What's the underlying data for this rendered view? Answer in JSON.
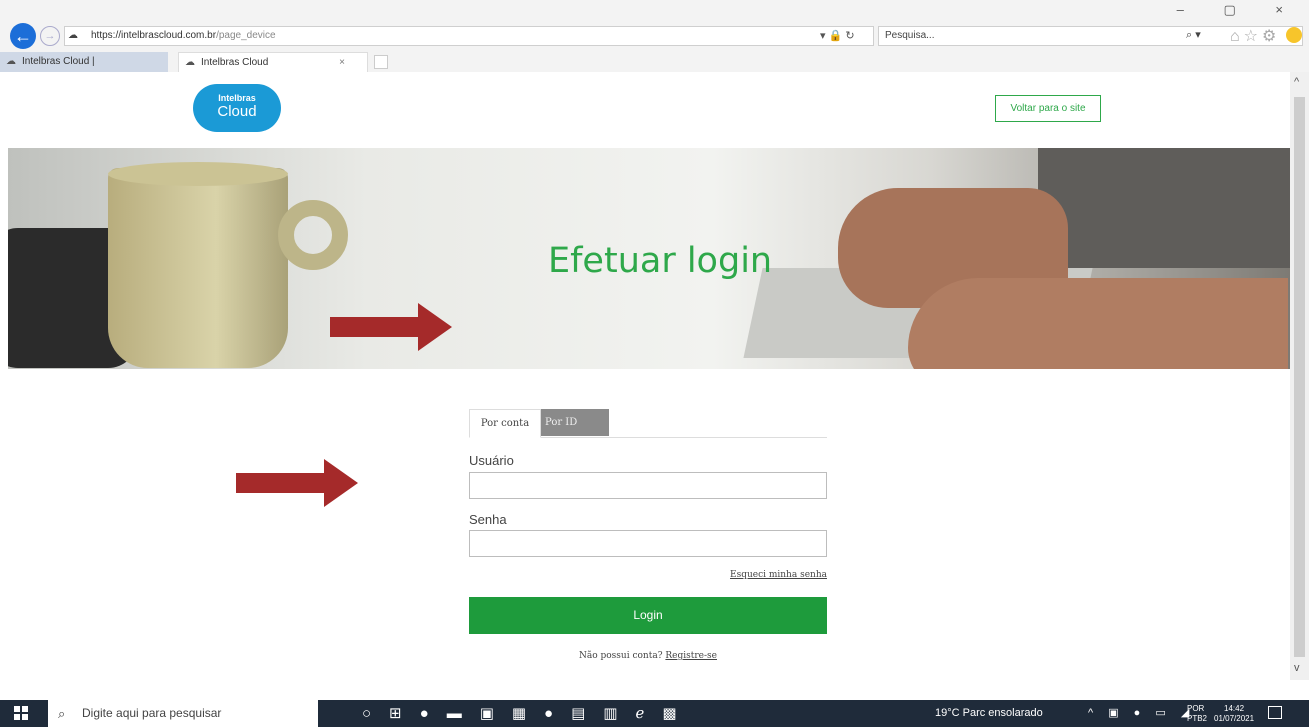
{
  "browser": {
    "url_host": "https://intelbrascloud.com.br",
    "url_path": "/page_device",
    "search_placeholder": "Pesquisa...",
    "tabs": [
      {
        "label": "Intelbras Cloud |"
      },
      {
        "label": "Intelbras Cloud",
        "close": "×"
      }
    ],
    "window_controls": "–  ▢  ×"
  },
  "header": {
    "logo_top": "Intelbras",
    "logo_bottom": "Cloud",
    "back_to_site": "Voltar para o site"
  },
  "hero": {
    "title": "Efetuar login"
  },
  "login": {
    "tabs": [
      {
        "label": "Por conta",
        "active": true
      },
      {
        "label": "Por ID",
        "active": false
      }
    ],
    "username_label": "Usuário",
    "username_value": "",
    "password_label": "Senha",
    "password_value": "",
    "forgot_link": "Esqueci minha senha",
    "submit": "Login",
    "no_account_text": "Não possui conta?",
    "register_link": "Registre-se"
  },
  "taskbar": {
    "search_placeholder": "Digite aqui para pesquisar",
    "weather": "19°C  Parc ensolarado",
    "lang_line1": "POR",
    "lang_line2": "PTB2",
    "time": "14:42",
    "date": "01/07/2021"
  },
  "colors": {
    "brand_green": "#2ea84a",
    "login_button": "#1e9b3c",
    "logo_blue": "#1b9ad6",
    "annotation_arrow": "#a52a2a"
  }
}
